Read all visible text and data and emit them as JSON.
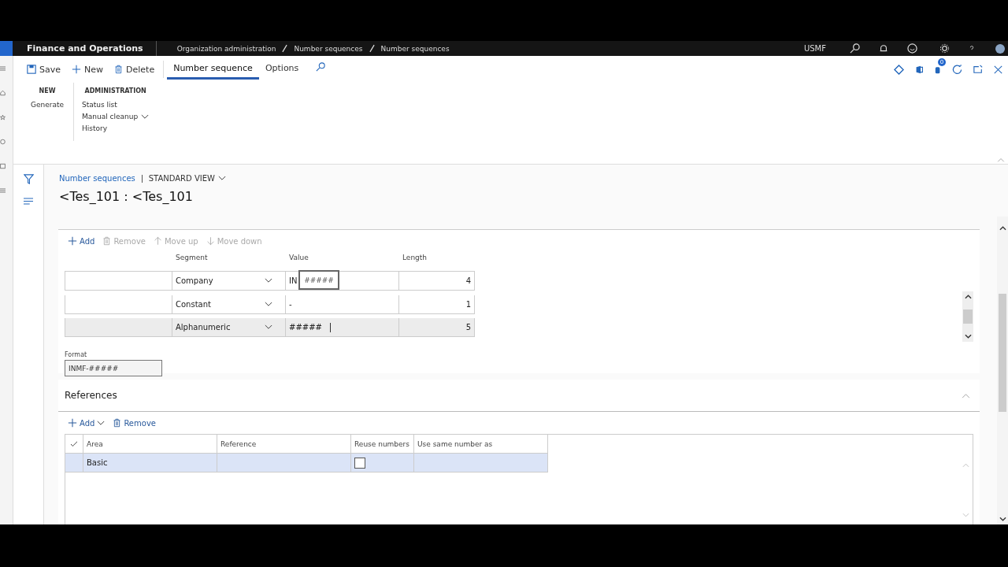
{
  "top_bar": {
    "app_name": "Finance and Operations",
    "breadcrumbs": [
      "Organization administration",
      "Number sequences",
      "Number sequences"
    ],
    "company": "USMF"
  },
  "action_pane": {
    "buttons": [
      {
        "label": "Save",
        "kind": "save"
      },
      {
        "label": "New",
        "kind": "add"
      },
      {
        "label": "Delete",
        "kind": "delete"
      }
    ],
    "tabs": [
      {
        "label": "Number sequence",
        "selected": true
      },
      {
        "label": "Options",
        "selected": false
      }
    ],
    "notification_count": "0"
  },
  "ribbon": {
    "groups": [
      {
        "title": "NEW",
        "items": [
          {
            "label": "Generate",
            "dropdown": false
          }
        ]
      },
      {
        "title": "ADMINISTRATION",
        "items": [
          {
            "label": "Status list",
            "dropdown": false
          },
          {
            "label": "Manual cleanup",
            "dropdown": true
          },
          {
            "label": "History",
            "dropdown": false
          }
        ]
      }
    ]
  },
  "page": {
    "breadcrumb_link": "Number sequences",
    "view": "STANDARD VIEW",
    "title": "<Tes_101 : <Tes_101"
  },
  "segments": {
    "toolbar": [
      {
        "label": "Add",
        "kind": "add",
        "disabled": false
      },
      {
        "label": "Remove",
        "kind": "delete",
        "disabled": true
      },
      {
        "label": "Move up",
        "kind": "up",
        "disabled": true
      },
      {
        "label": "Move down",
        "kind": "down",
        "disabled": true
      }
    ],
    "columns": [
      "Segment",
      "Value",
      "Length"
    ],
    "rows": [
      {
        "segment": "Company",
        "value": "IN",
        "length": "4",
        "selected": false
      },
      {
        "segment": "Constant",
        "value": "-",
        "length": "1",
        "selected": false
      },
      {
        "segment": "Alphanumeric",
        "value": "#####",
        "length": "5",
        "selected": true
      }
    ],
    "tooltip": "#####",
    "format_label": "Format",
    "format_value": "INMF-#####"
  },
  "references": {
    "title": "References",
    "toolbar": [
      {
        "label": "Add",
        "kind": "add",
        "dropdown": true
      },
      {
        "label": "Remove",
        "kind": "delete",
        "dropdown": false
      }
    ],
    "columns": [
      "Area",
      "Reference",
      "Reuse numbers",
      "Use same number as"
    ],
    "rows": [
      {
        "area": "Basic",
        "reuse_numbers": false,
        "selected": true
      }
    ]
  }
}
